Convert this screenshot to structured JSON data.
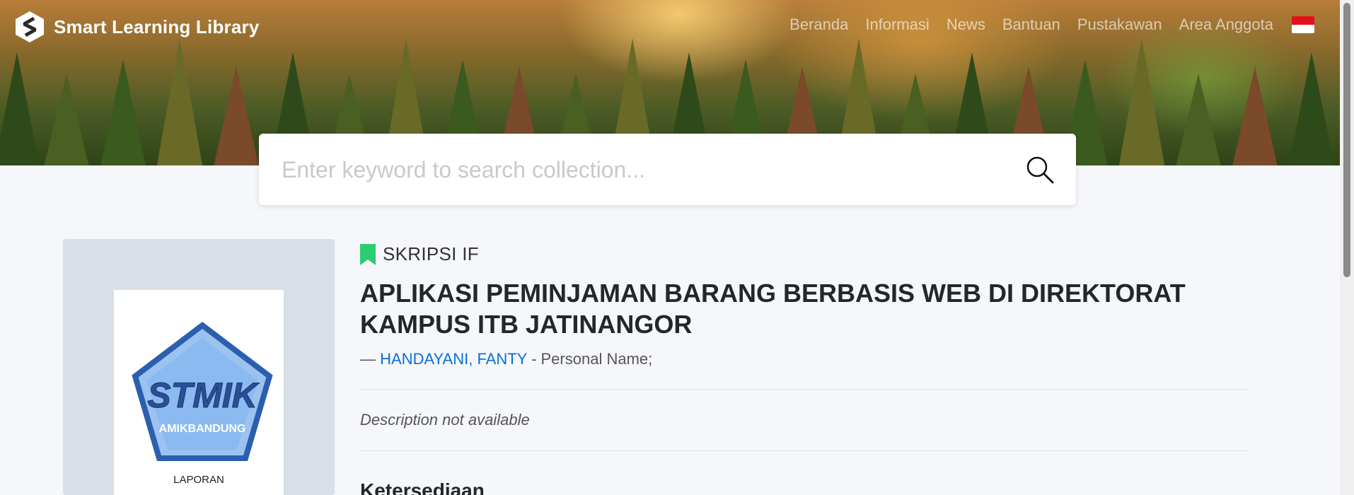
{
  "brand": {
    "name": "Smart Learning Library",
    "logo_icon": "library-s-logo-icon"
  },
  "nav": {
    "items": [
      {
        "label": "Beranda"
      },
      {
        "label": "Informasi"
      },
      {
        "label": "News"
      },
      {
        "label": "Bantuan"
      },
      {
        "label": "Pustakawan"
      },
      {
        "label": "Area Anggota"
      }
    ],
    "language_flag": "indonesia-flag-icon"
  },
  "search": {
    "placeholder": "Enter keyword to search collection...",
    "value": "",
    "icon": "search-icon"
  },
  "record": {
    "gmd": "SKRIPSI IF",
    "gmd_icon": "bookmark-icon",
    "title": "APLIKASI PEMINJAMAN BARANG BERBASIS WEB DI DIREKTORAT KAMPUS ITB JATINANGOR",
    "author_prefix": "—",
    "author_name": "HANDAYANI, FANTY",
    "author_type": " - Personal Name;",
    "description": "Description not available",
    "availability_heading": "Ketersediaan",
    "cover": {
      "logo_text": "STMIK",
      "logo_subtext": "AMIKBANDUNG",
      "caption": "LAPORAN"
    }
  },
  "colors": {
    "accent_link": "#0b6fd8",
    "bookmark": "#2ecc71",
    "flag_red": "#e3101b"
  }
}
